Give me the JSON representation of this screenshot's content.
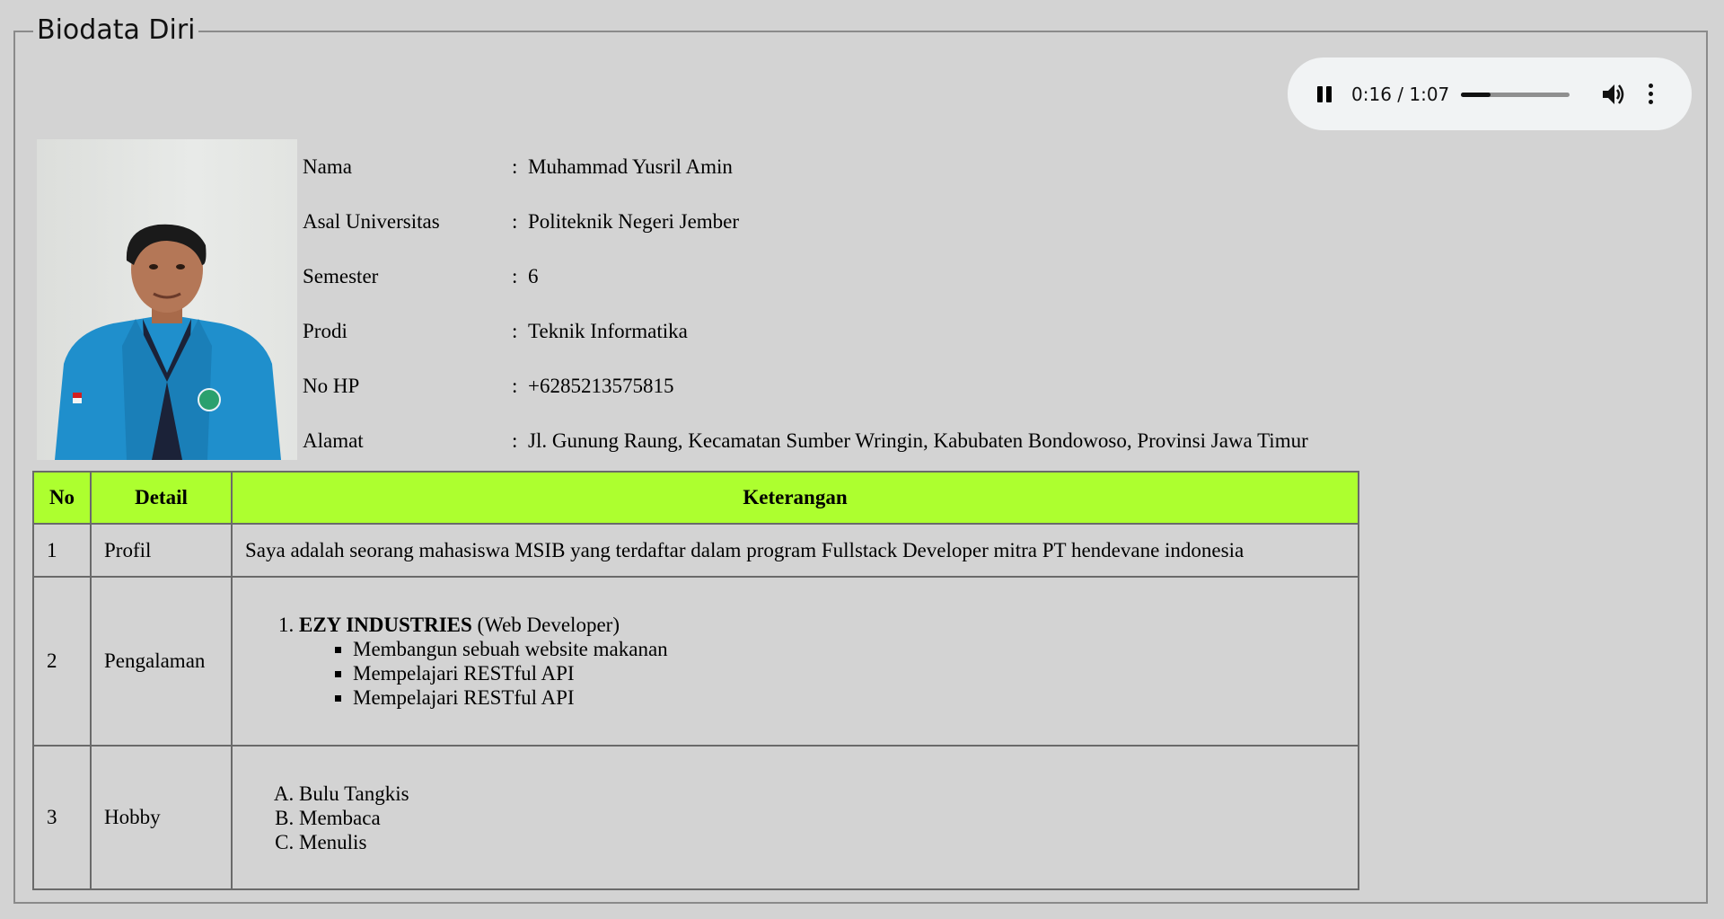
{
  "section": {
    "legend": "Biodata Diri"
  },
  "audio": {
    "time": "0:16 / 1:07",
    "progress_fraction": 0.27,
    "icons": [
      "pause-icon",
      "volume-icon",
      "more-vert-icon"
    ]
  },
  "profile": {
    "fields": [
      {
        "label": "Nama",
        "colon": ":",
        "value": "Muhammad Yusril Amin"
      },
      {
        "label": "Asal Universitas",
        "colon": ":",
        "value": "Politeknik Negeri Jember"
      },
      {
        "label": "Semester",
        "colon": ":",
        "value": "6"
      },
      {
        "label": "Prodi",
        "colon": ":",
        "value": "Teknik Informatika"
      },
      {
        "label": "No HP",
        "colon": ":",
        "value": "+6285213575815"
      },
      {
        "label": "Alamat",
        "colon": ":",
        "value": "Jl. Gunung Raung, Kecamatan Sumber Wringin, Kabubaten Bondowoso, Provinsi Jawa Timur"
      }
    ]
  },
  "table": {
    "headers": [
      "No",
      "Detail",
      "Keterangan"
    ],
    "header_color": "#adff2f",
    "rows": [
      {
        "no": "1",
        "detail": "Profil",
        "text": "Saya adalah seorang mahasiswa MSIB yang terdaftar dalam program Fullstack Developer mitra PT hendevane indonesia"
      },
      {
        "no": "2",
        "detail": "Pengalaman",
        "experience": {
          "company": "EZY INDUSTRIES",
          "role": " (Web Developer)",
          "items": [
            "Membangun sebuah website makanan",
            "Mempelajari RESTful API",
            "Mempelajari RESTful API"
          ]
        }
      },
      {
        "no": "3",
        "detail": "Hobby",
        "hobbies": [
          "Bulu Tangkis",
          "Membaca",
          "Menulis"
        ]
      }
    ]
  }
}
